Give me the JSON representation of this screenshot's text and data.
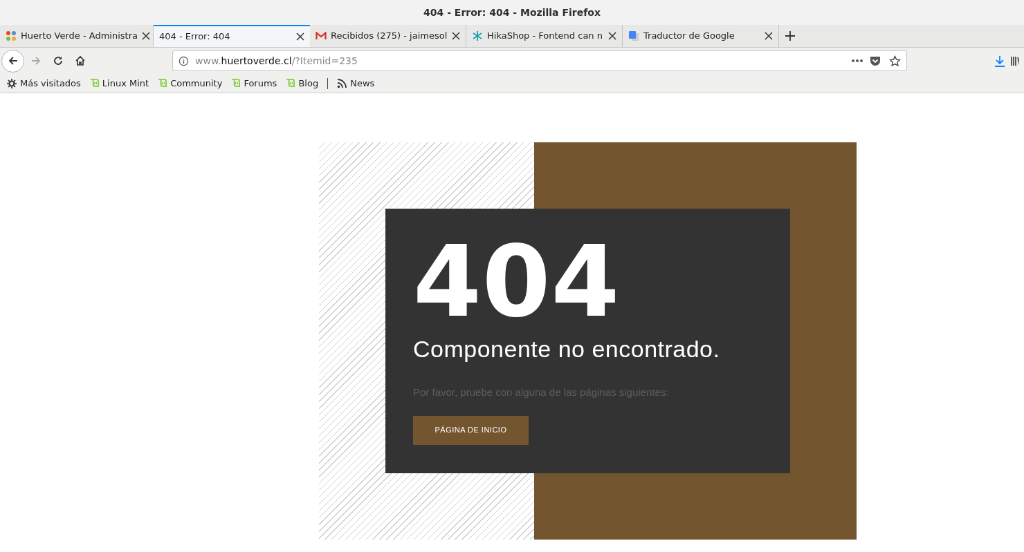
{
  "window": {
    "title": "404 - Error: 404 - Mozilla Firefox"
  },
  "tabs": [
    {
      "label": "Huerto Verde - Administra",
      "kind": "joomla",
      "selected": false
    },
    {
      "label": "404 - Error: 404",
      "kind": "none",
      "selected": true
    },
    {
      "label": "Recibidos (275) - jaimesol",
      "kind": "mail",
      "selected": false
    },
    {
      "label": "HikaShop - Fontend can n",
      "kind": "star",
      "selected": false
    },
    {
      "label": "Traductor de Google",
      "kind": "translate",
      "selected": false
    }
  ],
  "address_bar": {
    "prefix": "www.",
    "domain": "huertoverde.cl",
    "suffix": "/?Itemid=235"
  },
  "bookmarks": [
    {
      "label": "Más visitados",
      "kind": "gear"
    },
    {
      "label": "Linux Mint",
      "kind": "mint"
    },
    {
      "label": "Community",
      "kind": "mint"
    },
    {
      "label": "Forums",
      "kind": "mint"
    },
    {
      "label": "Blog",
      "kind": "mint"
    },
    {
      "label": "News",
      "kind": "rss"
    }
  ],
  "page": {
    "code": "404",
    "message": "Componente no encontrado.",
    "hint": "Por favor, pruebe con alguna de las páginas siguientes:",
    "button": "PÁGINA DE INICIO"
  }
}
